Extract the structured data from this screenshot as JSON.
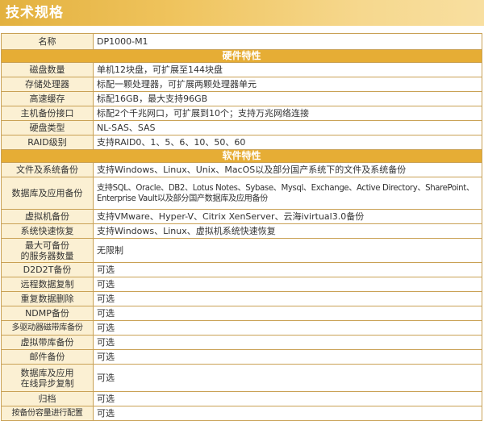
{
  "header": {
    "title": "技术规格"
  },
  "table": {
    "model": {
      "label": "名称",
      "value": "DP1000-M1"
    },
    "sections": [
      {
        "title": "硬件特性",
        "rows": [
          {
            "label": "磁盘数量",
            "value": "单机12块盘，可扩展至144块盘"
          },
          {
            "label": "存储处理器",
            "value": "标配一颗处理器，可扩展两颗处理器单元"
          },
          {
            "label": "高速缓存",
            "value": "标配16GB，最大支持96GB"
          },
          {
            "label": "主机备份接口",
            "value": "标配2个千兆网口，可扩展到10个；支持万兆网络连接"
          },
          {
            "label": "硬盘类型",
            "value": "NL-SAS、SAS"
          },
          {
            "label": "RAID级别",
            "value": "支持RAID0、1、5、6、10、50、60"
          }
        ]
      },
      {
        "title": "软件特性",
        "rows": [
          {
            "label": "文件及系统备份",
            "value": "支持Windows、Linux、Unix、MacOS以及部分国产系统下的文件及系统备份"
          },
          {
            "label": "数据库及应用备份",
            "value": "支持SQL、Oracle、DB2、Lotus Notes、Sybase、Mysql、Exchange、Active Directory、SharePoint、Enterprise Vault以及部分国产数据库及应用备份"
          },
          {
            "label": "虚拟机备份",
            "value": "支持VMware、Hyper-V、Citrix XenServer、云海ivirtual3.0备份"
          },
          {
            "label": "系统快速恢复",
            "value": "支持Windows、Linux、虚拟机系统快速恢复"
          },
          {
            "label": "最大可备份的服务器数量",
            "label_lines": [
              "最大可备份",
              "的服务器数量"
            ],
            "value": "无限制"
          },
          {
            "label": "D2D2T备份",
            "value": "可选"
          },
          {
            "label": "远程数据复制",
            "value": "可选"
          },
          {
            "label": "重复数据删除",
            "value": "可选"
          },
          {
            "label": "NDMP备份",
            "value": "可选"
          },
          {
            "label": "多驱动器磁带库备份",
            "value": "可选"
          },
          {
            "label": "虚拟带库备份",
            "value": "可选"
          },
          {
            "label": "邮件备份",
            "value": "可选"
          },
          {
            "label": "数据库及应用在线异步复制",
            "label_lines": [
              "数据库及应用",
              "在线异步复制"
            ],
            "value": "可选"
          },
          {
            "label": "归档",
            "value": "可选"
          },
          {
            "label": "按备份容量进行配置",
            "value": "可选"
          }
        ]
      }
    ]
  },
  "colors": {
    "header_gradient": [
      "#e3b13f",
      "#f8dfa0"
    ],
    "section_bg": "#e6ad35",
    "label_bg": "#fbf0d3",
    "border": "#c9a155"
  }
}
